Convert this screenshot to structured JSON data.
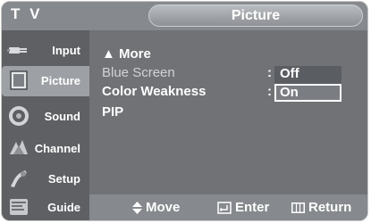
{
  "header": {
    "tv_label": "T V",
    "menu_title": "Picture"
  },
  "sidebar": {
    "items": [
      {
        "label": "Input",
        "icon": "input-plug-icon",
        "active": false
      },
      {
        "label": "Picture",
        "icon": "picture-icon",
        "active": true
      },
      {
        "label": "Sound",
        "icon": "speaker-icon",
        "active": false
      },
      {
        "label": "Channel",
        "icon": "channel-icon",
        "active": false
      },
      {
        "label": "Setup",
        "icon": "setup-icon",
        "active": false
      },
      {
        "label": "Guide",
        "icon": "guide-icon",
        "active": false
      }
    ]
  },
  "menu": {
    "more_label": "▲ More",
    "blue_screen_label": "Blue Screen",
    "color_weakness_label": "Color Weakness",
    "pip_label": "PIP",
    "colon": ":",
    "options": {
      "off": "Off",
      "on": "On",
      "selected": "On"
    }
  },
  "footer": {
    "move": "Move",
    "enter": "Enter",
    "return": "Return"
  },
  "colors": {
    "panel": "#707276",
    "sidebar": "#5e6064",
    "bars": "#86898d",
    "highlight": "#ffffff"
  }
}
